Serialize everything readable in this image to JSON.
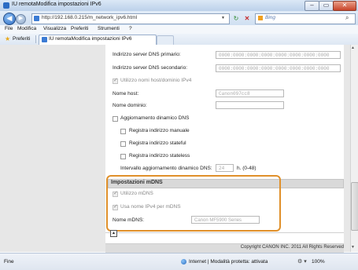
{
  "window": {
    "title": "IU remotaModifica impostazioni IPv6",
    "minimize": "–",
    "maximize": "▭",
    "close": "✕"
  },
  "address_bar": {
    "url": "http://192.168.0.215/m_network_ipv6.html",
    "search_placeholder": "Bing"
  },
  "menu": [
    "File",
    "Modifica",
    "Visualizza",
    "Preferiti",
    "Strumenti",
    "?"
  ],
  "favorites": {
    "label": "Preferiti",
    "tab_title": "IU remotaModifica impostazioni IPv6"
  },
  "form": {
    "dns_primary_label": "Indirizzo server DNS primario:",
    "dns_primary_value": "0000:0000:0000:0000:0000:0000:0000:0000",
    "dns_secondary_label": "Indirizzo server DNS secondario:",
    "dns_secondary_value": "0000:0000:0000:0000:0000:0000:0000:0000",
    "use_ipv4_host_label": "Utilizzo nomi host/dominio IPv4",
    "host_name_label": "Nome host:",
    "host_name_value": "Canon097cc8",
    "domain_name_label": "Nome dominio:",
    "domain_name_value": "",
    "ddns_label": "Aggiornamento dinamico DNS",
    "register_manual_label": "Registra indirizzo manuale",
    "register_stateful_label": "Registra indirizzo stateful",
    "register_stateless_label": "Registra indirizzo stateless",
    "ddns_interval_label": "Intervallo aggiornamento dinamico DNS:",
    "ddns_interval_value": "24",
    "ddns_interval_unit": "h. (0-48)"
  },
  "mdns": {
    "section_title": "Impostazioni mDNS",
    "use_mdns_label": "Utilizzo mDNS",
    "use_ipv4_name_label": "Usa nome IPv4 per mDNS",
    "mdns_name_label": "Nome mDNS:",
    "mdns_name_value": "Canon MF5900 Series"
  },
  "footer": {
    "copyright": "Copyright CANON INC. 2011 All Rights Reserved"
  },
  "status_bar": {
    "left": "Fine",
    "zone": "Internet | Modalità protetta: attivata",
    "zoom": "100%"
  }
}
